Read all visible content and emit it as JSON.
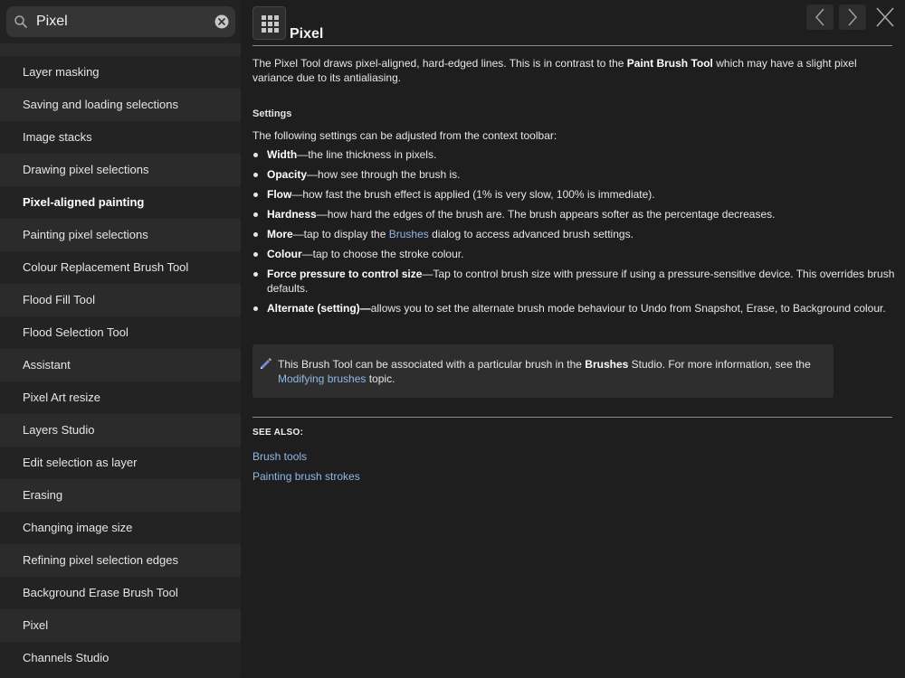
{
  "search": {
    "value": "Pixel"
  },
  "sidebar": {
    "items": [
      {
        "label": "Layer masking"
      },
      {
        "label": "Saving and loading selections"
      },
      {
        "label": "Image stacks"
      },
      {
        "label": "Drawing pixel selections"
      },
      {
        "label": "Pixel-aligned painting",
        "active": true
      },
      {
        "label": "Painting pixel selections"
      },
      {
        "label": "Colour Replacement Brush Tool"
      },
      {
        "label": "Flood Fill Tool"
      },
      {
        "label": "Flood Selection Tool"
      },
      {
        "label": "Assistant"
      },
      {
        "label": "Pixel Art resize"
      },
      {
        "label": "Layers Studio"
      },
      {
        "label": "Edit selection as layer"
      },
      {
        "label": "Erasing"
      },
      {
        "label": "Changing image size"
      },
      {
        "label": "Refining pixel selection edges"
      },
      {
        "label": "Background Erase Brush Tool"
      },
      {
        "label": "Pixel"
      },
      {
        "label": "Channels Studio"
      }
    ]
  },
  "page": {
    "title": "Pixel",
    "intro_1": "The Pixel Tool draws pixel-aligned, hard-edged lines. This is in contrast to the ",
    "intro_bold": "Paint Brush Tool",
    "intro_2": " which may have a slight pixel variance due to its antialiasing.",
    "settings_heading": "Settings",
    "settings_lead": "The following settings can be adjusted from the context toolbar:",
    "bullets": [
      {
        "term": "Width",
        "text": "—the line thickness in pixels."
      },
      {
        "term": "Opacity",
        "text": "—how see through the brush is."
      },
      {
        "term": "Flow",
        "text": "—how fast the brush effect is applied (1% is very slow, 100% is immediate)."
      },
      {
        "term": "Hardness",
        "text": "—how hard the edges of the brush are. The brush appears softer as the percentage decreases."
      },
      {
        "term": "More",
        "text_1": "—tap to display the ",
        "link": "Brushes",
        "text_2": " dialog to access advanced brush settings."
      },
      {
        "term": "Colour",
        "text": "—tap to choose the stroke colour."
      },
      {
        "term": "Force pressure to control size",
        "text": "—Tap to control brush size with pressure if using a pressure-sensitive device. This overrides brush defaults."
      },
      {
        "term": "Alternate (setting)—",
        "text": "allows you to set the alternate brush mode behaviour to Undo from Snapshot, Erase, to Background colour."
      }
    ],
    "note": {
      "text_1": "This Brush Tool can be associated with a particular brush in the ",
      "bold": "Brushes",
      "text_2": " Studio. For more information, see the ",
      "link": "Modifying brushes",
      "text_3": " topic."
    },
    "see_also_heading": "SEE ALSO:",
    "see_also": [
      "Brush tools",
      "Painting brush strokes"
    ]
  },
  "colors": {
    "link": "#8fb9e8",
    "background": "#1e1e1e",
    "sidebar": "#222222"
  },
  "icons": {
    "search": "search-icon",
    "clear": "clear-icon",
    "app": "grid-icon",
    "prev": "chevron-left-icon",
    "next": "chevron-right-icon",
    "close": "close-icon",
    "note": "pencil-icon"
  }
}
